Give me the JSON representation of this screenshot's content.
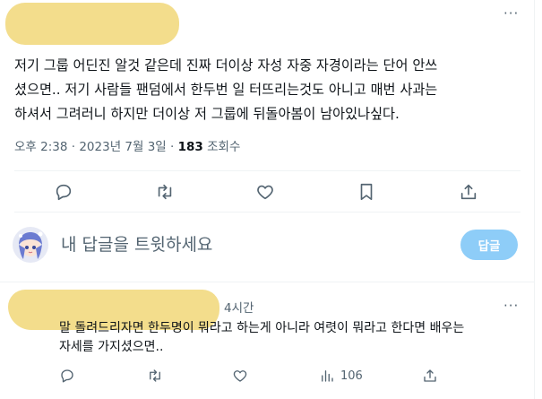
{
  "tweet": {
    "text_lines": [
      "저기 그룹 어딘진 알것 같은데 진짜 더이상 자성 자중 자경이라는 단어 안쓰",
      "셨으면.. 저기 사람들 팬덤에서 한두번 일 터뜨리는것도 아니고 매번 사과는",
      "하셔서 그려러니 하지만 더이상 저 그룹에 뒤돌아봄이 남아있나싶다."
    ],
    "time": "오후 2:38",
    "date": "2023년 7월 3일",
    "separator": "·",
    "views_count": "183",
    "views_label": "조회수",
    "more_label": "···"
  },
  "actions": {
    "icons": [
      "reply-icon",
      "retweet-icon",
      "like-icon",
      "bookmark-icon",
      "share-icon"
    ]
  },
  "composer": {
    "placeholder": "내 답글을 트윗하세요",
    "reply_button_label": "답글"
  },
  "reply": {
    "time": "4시간",
    "more_label": "···",
    "text_lines": [
      "말 돌려드리자면 한두명이 뭐라고 하는게 아니라 여렷이 뭐라고 한다면 배우는",
      "자세를 가지셨으면.."
    ],
    "views_count": "106"
  },
  "colors": {
    "redaction": "#f3dd8c",
    "muted": "#536471",
    "reply_button": "#8ecdf8",
    "divider": "#eff3f4"
  }
}
